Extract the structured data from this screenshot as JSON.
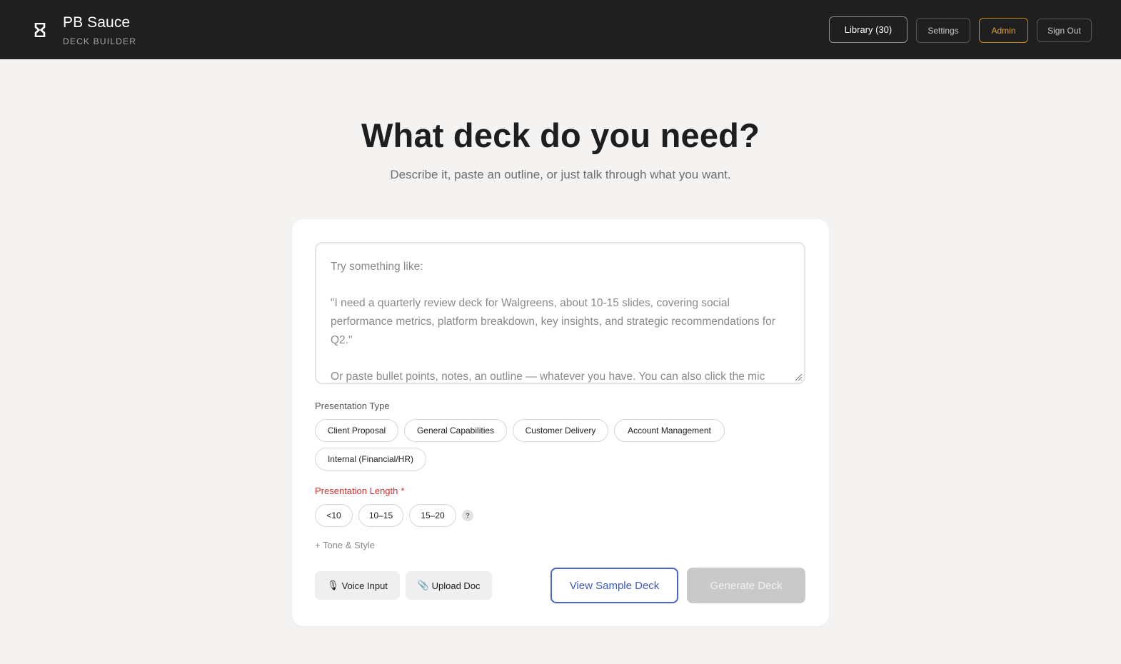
{
  "header": {
    "brand_title": "PB Sauce",
    "brand_subtitle": "DECK BUILDER",
    "library_label": "Library (30)",
    "settings_label": "Settings",
    "admin_label": "Admin",
    "signout_label": "Sign Out"
  },
  "hero": {
    "title": "What deck do you need?",
    "subtitle": "Describe it, paste an outline, or just talk through what you want."
  },
  "prompt": {
    "placeholder": "Try something like:\n\n\"I need a quarterly review deck for Walgreens, about 10-15 slides, covering social performance metrics, platform breakdown, key insights, and strategic recommendations for Q2.\"\n\nOr paste bullet points, notes, an outline — whatever you have. You can also click the mic"
  },
  "presentation_type": {
    "label": "Presentation Type",
    "options": [
      "Client Proposal",
      "General Capabilities",
      "Customer Delivery",
      "Account Management",
      "Internal (Financial/HR)"
    ]
  },
  "presentation_length": {
    "label": "Presentation Length",
    "required_mark": "*",
    "options": [
      "<10",
      "10–15",
      "15–20"
    ],
    "help": "?"
  },
  "tone_link": "+ Tone & Style",
  "actions": {
    "voice_icon": "🎙",
    "voice_label": "Voice Input",
    "upload_icon": "📎",
    "upload_label": "Upload Doc",
    "sample_label": "View Sample Deck",
    "generate_label": "Generate Deck"
  },
  "colors": {
    "header_bg": "#1f1f1f",
    "page_bg": "#f4f3f1",
    "admin_accent": "#e6a232",
    "required_red": "#d0322e",
    "sample_blue": "#3e5bbf",
    "disabled_gray": "#c9c9c9"
  }
}
